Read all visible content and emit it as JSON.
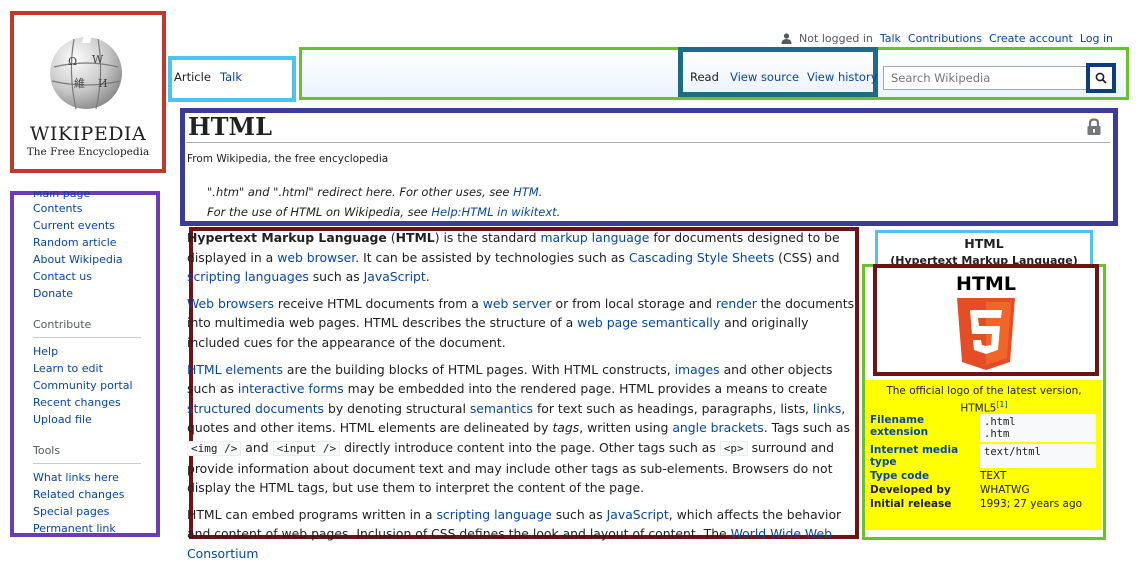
{
  "logo": {
    "wordmark": "WIKIPEDIA",
    "tagline": "The Free Encyclopedia"
  },
  "personal_tools": {
    "status": "Not logged in",
    "items": [
      "Talk",
      "Contributions",
      "Create account",
      "Log in"
    ]
  },
  "namespaces": {
    "article": "Article",
    "talk": "Talk"
  },
  "views": {
    "read": "Read",
    "source": "View source",
    "history": "View history"
  },
  "search": {
    "placeholder": "Search Wikipedia"
  },
  "page": {
    "title": "HTML",
    "tagline": "From Wikipedia, the free encyclopedia",
    "hatnote1": {
      "pre": "\".htm\" and \".html\" redirect here. For other uses, see ",
      "link": "HTM",
      "post": "."
    },
    "hatnote2": {
      "pre": "For the use of HTML on Wikipedia, see ",
      "link": "Help:HTML in wikitext",
      "post": "."
    }
  },
  "sidebar": {
    "main_page": "Main page",
    "nav": [
      "Contents",
      "Current events",
      "Random article",
      "About Wikipedia",
      "Contact us",
      "Donate"
    ],
    "contribute_heading": "Contribute",
    "contribute": [
      "Help",
      "Learn to edit",
      "Community portal",
      "Recent changes",
      "Upload file"
    ],
    "tools_heading": "Tools",
    "tools": [
      "What links here",
      "Related changes",
      "Special pages",
      "Permanent link"
    ]
  },
  "body": {
    "p1": [
      {
        "t": "Hypertext Markup Language",
        "s": "b"
      },
      {
        "t": " ("
      },
      {
        "t": "HTML",
        "s": "b"
      },
      {
        "t": ") is the standard "
      },
      {
        "t": "markup language",
        "s": "a"
      },
      {
        "t": " for documents designed to be displayed in a "
      },
      {
        "t": "web browser",
        "s": "a"
      },
      {
        "t": ". It can be assisted by technologies such as "
      },
      {
        "t": "Cascading Style Sheets",
        "s": "a"
      },
      {
        "t": " (CSS) and "
      },
      {
        "t": "scripting languages",
        "s": "a"
      },
      {
        "t": " such as "
      },
      {
        "t": "JavaScript",
        "s": "a"
      },
      {
        "t": "."
      }
    ],
    "p2": [
      {
        "t": "Web browsers",
        "s": "a"
      },
      {
        "t": " receive HTML documents from a "
      },
      {
        "t": "web server",
        "s": "a"
      },
      {
        "t": " or from local storage and "
      },
      {
        "t": "render",
        "s": "a"
      },
      {
        "t": " the documents into multimedia web pages. HTML describes the structure of a "
      },
      {
        "t": "web page",
        "s": "a"
      },
      {
        "t": " "
      },
      {
        "t": "semantically",
        "s": "a"
      },
      {
        "t": " and originally included cues for the appearance of the document."
      }
    ],
    "p3": [
      {
        "t": "HTML elements",
        "s": "a"
      },
      {
        "t": " are the building blocks of HTML pages. With HTML constructs, "
      },
      {
        "t": "images",
        "s": "a"
      },
      {
        "t": " and other objects such as "
      },
      {
        "t": "interactive forms",
        "s": "a"
      },
      {
        "t": " may be embedded into the rendered page. HTML provides a means to create "
      },
      {
        "t": "structured documents",
        "s": "a"
      },
      {
        "t": " by denoting structural "
      },
      {
        "t": "semantics",
        "s": "a"
      },
      {
        "t": " for text such as headings, paragraphs, lists, "
      },
      {
        "t": "links",
        "s": "a"
      },
      {
        "t": ", quotes and other items. HTML elements are delineated by "
      },
      {
        "t": "tags",
        "s": "i"
      },
      {
        "t": ", written using "
      },
      {
        "t": "angle brackets",
        "s": "a"
      },
      {
        "t": ". Tags such as "
      },
      {
        "t": "<img />",
        "s": "c"
      },
      {
        "t": " and "
      },
      {
        "t": "<input />",
        "s": "c"
      },
      {
        "t": " directly introduce content into the page. Other tags such as "
      },
      {
        "t": "<p>",
        "s": "c"
      },
      {
        "t": " surround and provide information about document text and may include other tags as sub-elements. Browsers do not display the HTML tags, but use them to interpret the content of the page."
      }
    ],
    "p4": [
      {
        "t": "HTML can embed programs written in a "
      },
      {
        "t": "scripting language",
        "s": "a"
      },
      {
        "t": " such as "
      },
      {
        "t": "JavaScript",
        "s": "a"
      },
      {
        "t": ", which affects the behavior and content of web pages. Inclusion of CSS defines the look and layout of content. The "
      },
      {
        "t": "World Wide Web Consortium",
        "s": "a"
      }
    ]
  },
  "infobox": {
    "title": "HTML",
    "subtitle": "(Hypertext Markup Language)",
    "logo_text": "HTML",
    "caption": "The official logo of the latest version, HTML5",
    "caption_ref": "[1]",
    "rows": [
      {
        "key": "Filename extension",
        "values": [
          ".html",
          ".htm"
        ],
        "boxed": true,
        "linked": true
      },
      {
        "key": "Internet media type",
        "values": [
          "text/html"
        ],
        "boxed": true,
        "linked": true
      },
      {
        "key": "Type code",
        "values": [
          "TEXT"
        ],
        "boxed": false,
        "linked": true
      },
      {
        "key": "Developed by",
        "values": [
          "WHATWG"
        ],
        "boxed": false,
        "linked": false
      },
      {
        "key": "Initial release",
        "values": [
          "1993; 27 years ago"
        ],
        "boxed": false,
        "linked": false
      }
    ]
  },
  "colors": {
    "link": "#0645ad",
    "html5_orange": "#e44d26",
    "html5_light": "#f16529",
    "highlight": "#ffff00"
  }
}
